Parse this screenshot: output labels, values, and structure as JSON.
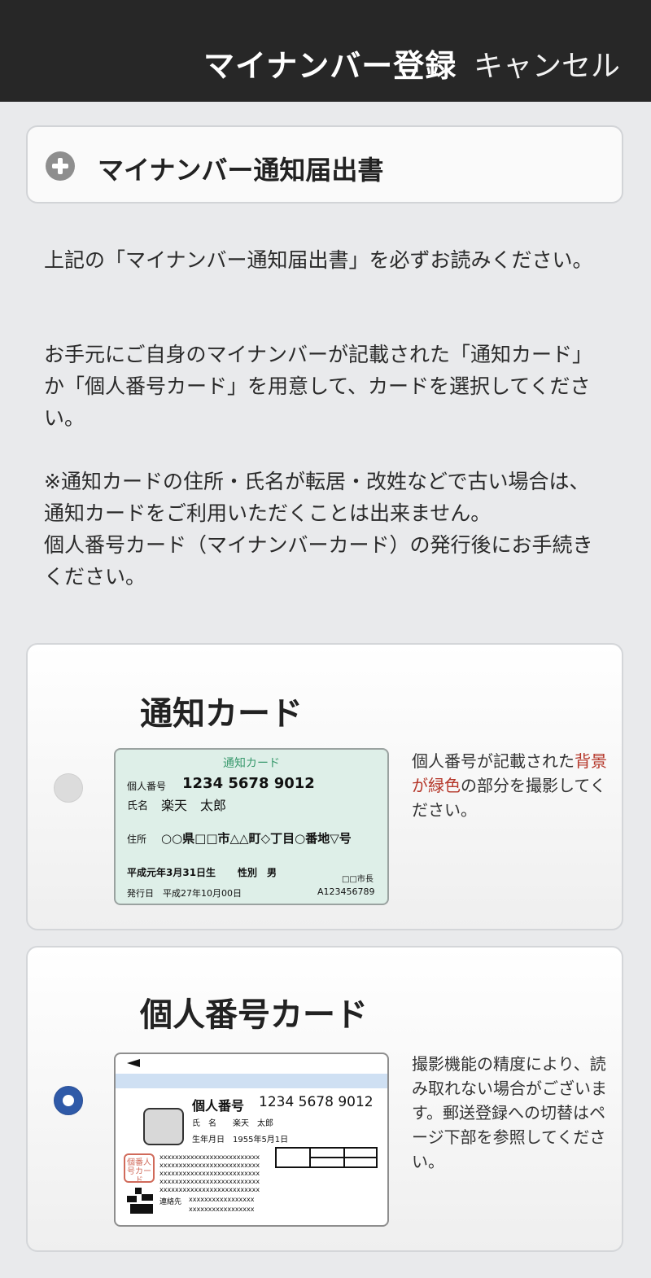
{
  "header": {
    "title": "マイナンバー登録",
    "cancel_label": "キャンセル"
  },
  "notice_button": {
    "label": "マイナンバー通知届出書",
    "icon": "plus-circle-icon"
  },
  "instructions": {
    "p1": "上記の「マイナンバー通知届出書」を必ずお読みください。",
    "p2": "お手元にご自身のマイナンバーが記載された「通知カード」か「個人番号カード」を用意して、カードを選択してください。",
    "p3a": "※通知カードの住所・氏名が転居・改姓などで古い場合は、通知カードをご利用いただくことは出来ません。",
    "p3b": "個人番号カード（マイナンバーカード）の発行後にお手続きください。"
  },
  "options": [
    {
      "title": "通知カード",
      "selected": false,
      "note_pre": "個人番号が記載された",
      "note_red": "背景が緑色",
      "note_post": "の部分を撮影してください。",
      "card": {
        "header": "通知カード",
        "number_label": "個人番号",
        "number": "1234 5678 9012",
        "name_label": "氏名",
        "name": "楽天　太郎",
        "address_label": "住所",
        "address": "○○県□□市△△町◇丁目○番地▽号",
        "birth": "平成元年3月31日生",
        "sex": "性別　男",
        "mayor": "□□市長",
        "issued": "発行日　平成27年10月00日",
        "serial": "A123456789"
      }
    },
    {
      "title": "個人番号カード",
      "selected": true,
      "note": "撮影機能の精度により、読み取れない場合がございます。郵送登録への切替はページ下部を参照してください。",
      "card": {
        "number_label": "個人番号",
        "number": "1234 5678 9012",
        "name_label": "氏　名",
        "name": "楽天　太郎",
        "birth_label": "生年月日",
        "birth": "1955年5月1日",
        "stamp": "個番人号カード",
        "xline": "xxxxxxxxxxxxxxxxxxxxxxxxxx",
        "contact_label": "連絡先",
        "contact": "xxxxxxxxxxxxxxxxx",
        "contact2": "xxxxxxxxxxxxxxxxx"
      }
    }
  ],
  "colors": {
    "header_bg": "#272727",
    "accent_blue": "#2f5aa8",
    "note_red": "#b5372a",
    "card_green": "#deefe8"
  }
}
